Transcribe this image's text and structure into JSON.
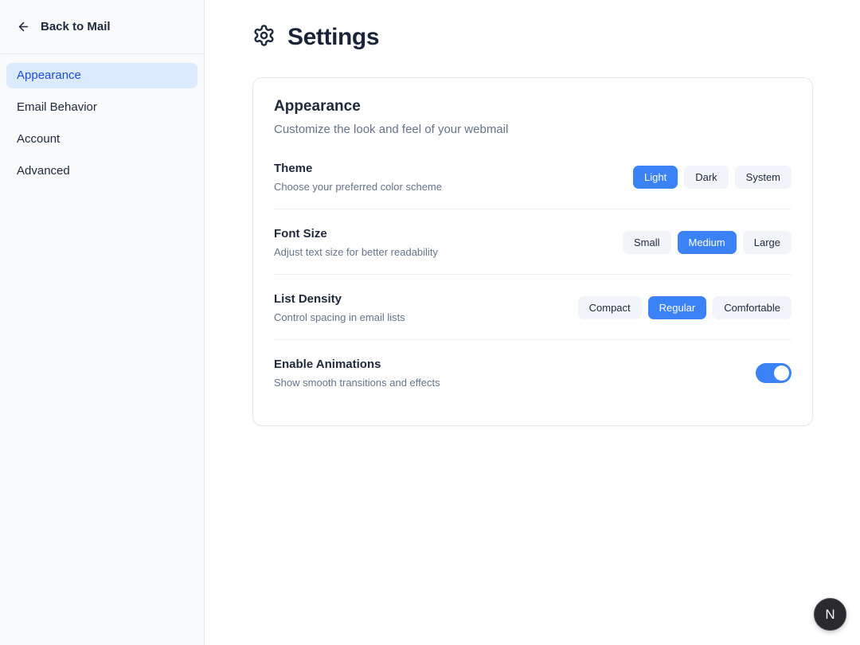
{
  "sidebar": {
    "back_label": "Back to Mail",
    "items": [
      {
        "label": "Appearance",
        "active": true
      },
      {
        "label": "Email Behavior",
        "active": false
      },
      {
        "label": "Account",
        "active": false
      },
      {
        "label": "Advanced",
        "active": false
      }
    ]
  },
  "header": {
    "title": "Settings"
  },
  "card": {
    "title": "Appearance",
    "subtitle": "Customize the look and feel of your webmail",
    "rows": [
      {
        "title": "Theme",
        "description": "Choose your preferred color scheme",
        "type": "buttons",
        "options": [
          "Light",
          "Dark",
          "System"
        ],
        "selected": "Light"
      },
      {
        "title": "Font Size",
        "description": "Adjust text size for better readability",
        "type": "buttons",
        "options": [
          "Small",
          "Medium",
          "Large"
        ],
        "selected": "Medium"
      },
      {
        "title": "List Density",
        "description": "Control spacing in email lists",
        "type": "buttons",
        "options": [
          "Compact",
          "Regular",
          "Comfortable"
        ],
        "selected": "Regular"
      },
      {
        "title": "Enable Animations",
        "description": "Show smooth transitions and effects",
        "type": "toggle",
        "value": true
      }
    ]
  },
  "floating_badge": {
    "label": "N"
  },
  "colors": {
    "accent": "#3b82f6",
    "nav_active_bg": "#dbeafe",
    "nav_active_text": "#1d4ed8",
    "button_bg": "#f1f5f9"
  }
}
